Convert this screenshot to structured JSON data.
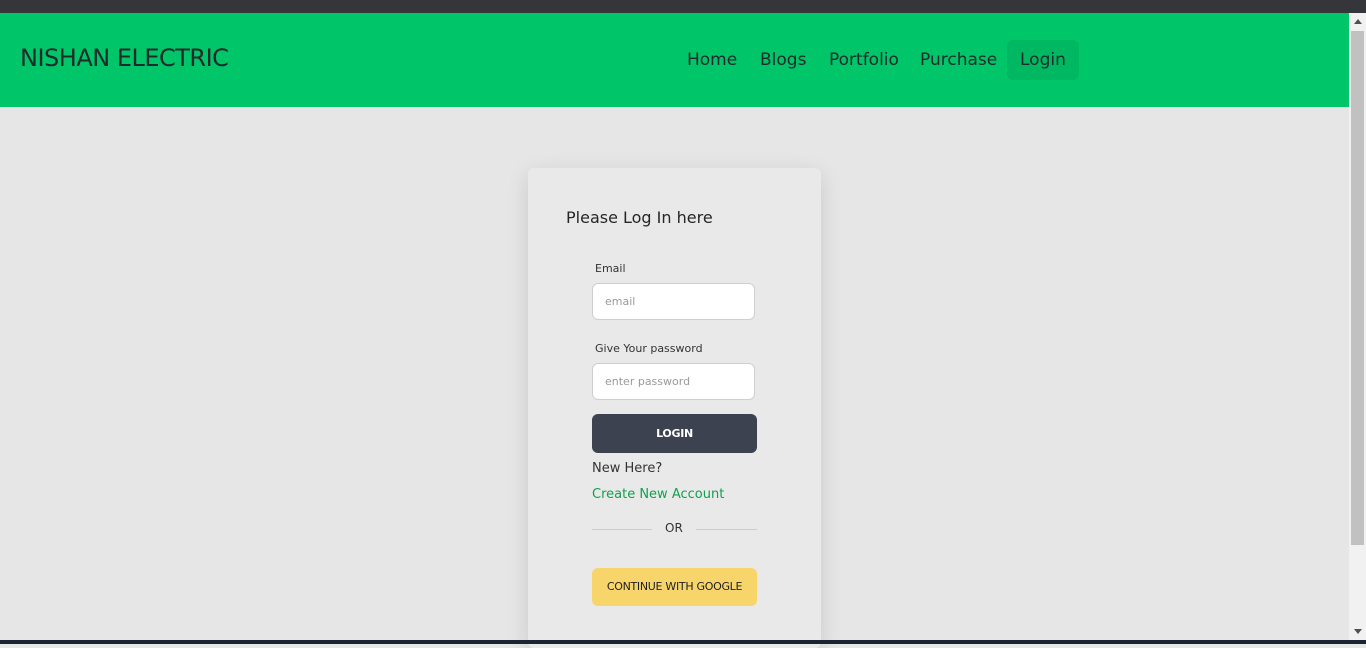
{
  "navbar": {
    "brand": "NISHAN ELECTRIC",
    "links": [
      {
        "label": "Home"
      },
      {
        "label": "Blogs"
      },
      {
        "label": "Portfolio"
      },
      {
        "label": "Purchase"
      },
      {
        "label": "Login",
        "active": true
      }
    ]
  },
  "login_card": {
    "title": "Please Log In here",
    "email_label": "Email",
    "email_placeholder": "email",
    "email_value": "",
    "password_label": "Give Your password",
    "password_placeholder": "enter password",
    "password_value": "",
    "login_button": "LOGIN",
    "new_here_text": "New Here?",
    "create_account_link": "Create New Account",
    "divider_text": "OR",
    "google_button": "CONTINUE WITH GOOGLE"
  },
  "colors": {
    "navbar_bg": "#00c569",
    "page_bg": "#e6e6e6",
    "login_button_bg": "#3d4250",
    "google_button_bg": "#f7d56b",
    "link_color": "#12a04e"
  }
}
